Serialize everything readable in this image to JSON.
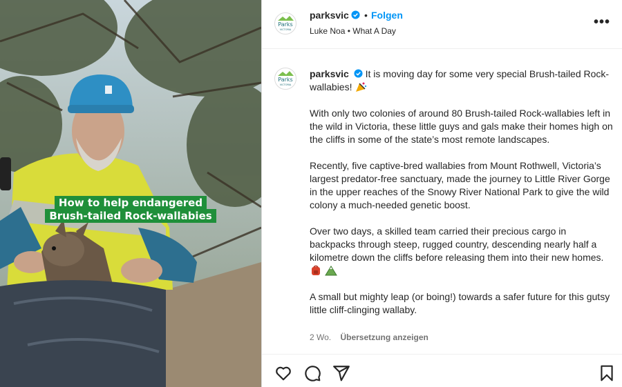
{
  "media": {
    "caption_line1": "How to help endangered",
    "caption_line2": "Brush-tailed Rock-wallabies"
  },
  "header": {
    "username": "parksvic",
    "dot": "•",
    "follow_label": "Folgen",
    "audio": "Luke Noa • What A Day",
    "more_label": "•••",
    "avatar_text_line1": "Parks",
    "avatar_text_line2": "VICTORIA"
  },
  "post": {
    "username": "parksvic",
    "paragraph1": "It is moving day for some very special Brush-tailed Rock-wallabies!",
    "paragraph2": "With only two colonies of around 80 Brush-tailed Rock-wallabies left in the wild in Victoria, these little guys and gals make their homes high on the cliffs in some of the state’s most remote landscapes.",
    "paragraph3": "Recently, five captive-bred wallabies from Mount Rothwell, Victoria’s largest predator-free sanctuary, made the journey to Little River Gorge in the upper reaches of the Snowy River National Park to give the wild colony a much-needed genetic boost.",
    "paragraph4": "Over two days, a skilled team carried their precious cargo in backpacks through steep, rugged country, descending nearly half a kilometre down the cliffs before releasing them into their new homes.",
    "paragraph5": "A small but mighty leap (or boing!) towards a safer future for this gutsy little cliff-clinging wallaby.",
    "time": "2 Wo.",
    "translate_label": "Übersetzung anzeigen"
  },
  "actions": {
    "like_icon": "heart-icon",
    "comment_icon": "comment-icon",
    "share_icon": "share-icon",
    "save_icon": "bookmark-icon"
  },
  "colors": {
    "accent": "#0095f6",
    "caption_bg": "#1f8f3a",
    "helmet": "#2e8fc4",
    "hi_vis": "#e3e33a"
  }
}
